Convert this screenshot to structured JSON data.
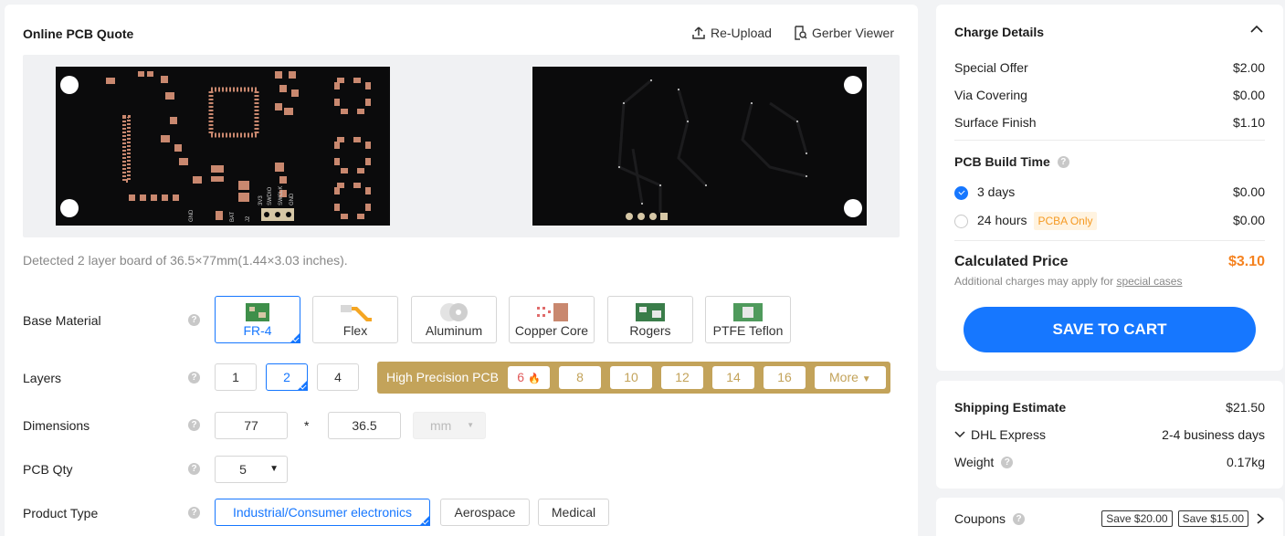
{
  "quote": {
    "title": "Online PCB Quote",
    "reupload_label": "Re-Upload",
    "gerber_label": "Gerber Viewer",
    "detect_text": "Detected 2 layer board of 36.5×77mm(1.44×3.03 inches).",
    "silk": {
      "gnd1": "GND",
      "bat": "BAT",
      "j2": "J2",
      "v33": "3V3",
      "swdio": "SWDIO",
      "swclk": "SWCLK",
      "gnd2": "GND"
    }
  },
  "base_material": {
    "label": "Base Material",
    "options": [
      "FR-4",
      "Flex",
      "Aluminum",
      "Copper Core",
      "Rogers",
      "PTFE Teflon"
    ],
    "selected": "FR-4"
  },
  "layers": {
    "label": "Layers",
    "options": [
      "1",
      "2",
      "4"
    ],
    "selected": "2",
    "high_precision_label": "High Precision PCB",
    "high_precision_options": [
      "6",
      "8",
      "10",
      "12",
      "14",
      "16"
    ],
    "more_label": "More"
  },
  "dimensions": {
    "label": "Dimensions",
    "length": "77",
    "width": "36.5",
    "separator": "*",
    "unit": "mm"
  },
  "qty": {
    "label": "PCB Qty",
    "value": "5"
  },
  "product_type": {
    "label": "Product Type",
    "options": [
      "Industrial/Consumer electronics",
      "Aerospace",
      "Medical"
    ],
    "selected": "Industrial/Consumer electronics"
  },
  "charge": {
    "title": "Charge Details",
    "items": [
      {
        "label": "Special Offer",
        "value": "$2.00"
      },
      {
        "label": "Via Covering",
        "value": "$0.00"
      },
      {
        "label": "Surface Finish",
        "value": "$1.10"
      }
    ],
    "build_time_label": "PCB Build Time",
    "build_options": [
      {
        "label": "3 days",
        "value": "$0.00",
        "selected": true
      },
      {
        "label": "24 hours",
        "value": "$0.00",
        "selected": false,
        "tag": "PCBA Only"
      }
    ],
    "calculated_label": "Calculated Price",
    "calculated_value": "$3.10",
    "note_prefix": "Additional charges may apply for ",
    "note_link": "special cases",
    "save_label": "SAVE TO CART"
  },
  "shipping": {
    "title": "Shipping Estimate",
    "cost": "$21.50",
    "carrier": "DHL Express",
    "carrier_time": "2-4 business days",
    "weight_label": "Weight",
    "weight_value": "0.17kg"
  },
  "coupons": {
    "label": "Coupons",
    "items": [
      "Save $20.00",
      "Save $15.00"
    ]
  },
  "colors": {
    "accent": "#1677ff",
    "price": "#f5821f",
    "gold": "#c3a35a",
    "copper": "#c9886f"
  }
}
